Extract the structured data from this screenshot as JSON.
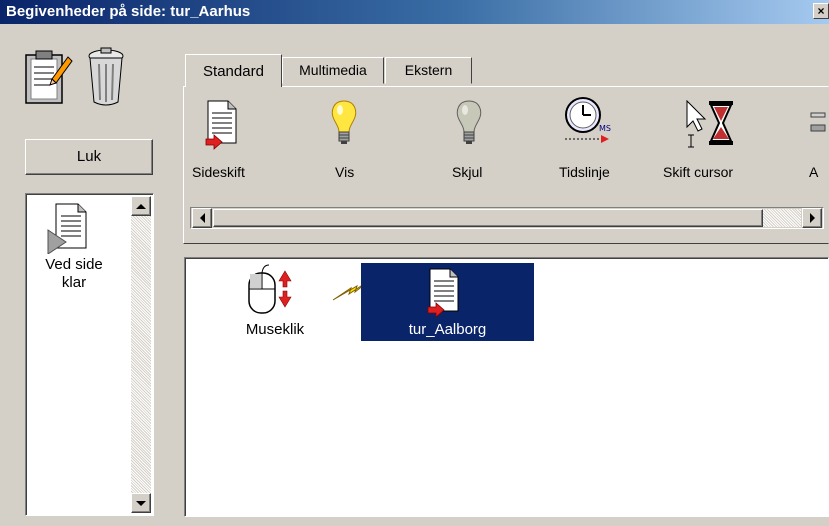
{
  "window": {
    "title": "Begivenheder på side: tur_Aarhus",
    "close_glyph": "×"
  },
  "toolbar": {
    "clipboard_icon": "clipboard-edit-icon",
    "trash_icon": "trash-can-icon",
    "close_button_label": "Luk"
  },
  "event_list": {
    "items": [
      {
        "label": "Ved side klar",
        "icon": "page-play-icon"
      }
    ]
  },
  "tabs": [
    {
      "label": "Standard",
      "active": true
    },
    {
      "label": "Multimedia",
      "active": false
    },
    {
      "label": "Ekstern",
      "active": false
    }
  ],
  "actions": [
    {
      "label": "Sideskift",
      "icon": "page-switch-icon"
    },
    {
      "label": "Vis",
      "icon": "lightbulb-on-icon"
    },
    {
      "label": "Skjul",
      "icon": "lightbulb-off-icon"
    },
    {
      "label": "Tidslinje",
      "icon": "timeline-clock-icon"
    },
    {
      "label": "Skift cursor",
      "icon": "cursor-hourglass-icon"
    },
    {
      "label": "A",
      "icon": "partial-action-icon"
    }
  ],
  "canvas": {
    "trigger": {
      "label": "Museklik",
      "icon": "mouse-click-icon"
    },
    "connector_icon": "lightning-bolt-icon",
    "target": {
      "label": "tur_Aalborg",
      "icon": "page-switch-icon",
      "selected": true
    }
  },
  "colors": {
    "titlebar_start": "#0a246a",
    "titlebar_end": "#a6caf0",
    "selection": "#0a246a",
    "face": "#d4d0c8"
  }
}
